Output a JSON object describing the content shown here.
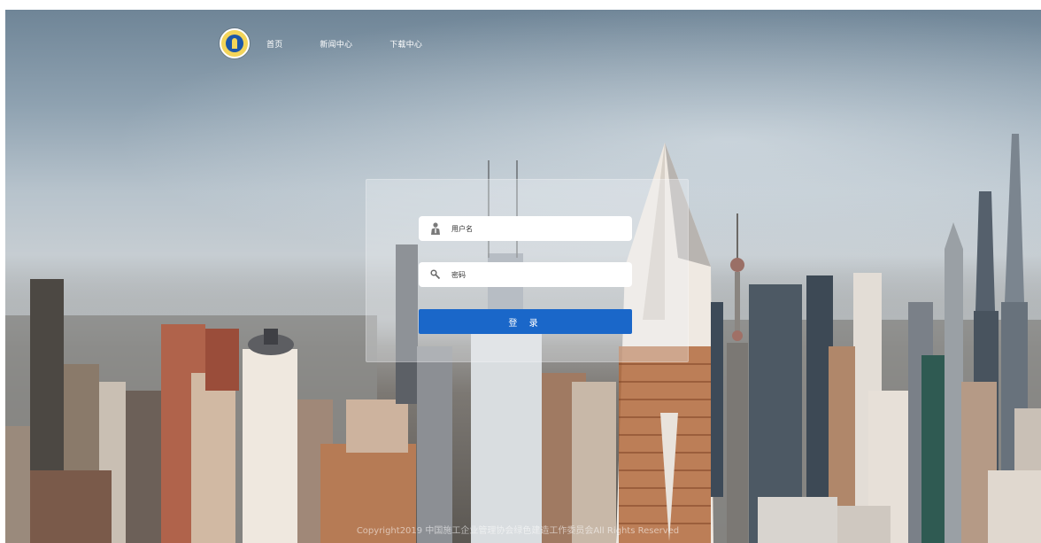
{
  "nav": {
    "items": [
      {
        "label": "首页"
      },
      {
        "label": "新闻中心"
      },
      {
        "label": "下载中心"
      }
    ]
  },
  "login": {
    "username_placeholder": "用户名",
    "password_placeholder": "密码",
    "submit_label": "登 录"
  },
  "footer": {
    "copyright": "Copyright2019 中国施工企业管理协会绿色建造工作委员会All Rights Reserved"
  },
  "colors": {
    "primary_button": "#1a67c9",
    "logo_blue": "#1d56a8",
    "logo_gold": "#f3d45a"
  },
  "icons": [
    "logo-emblem",
    "user-icon",
    "search-key-icon"
  ]
}
